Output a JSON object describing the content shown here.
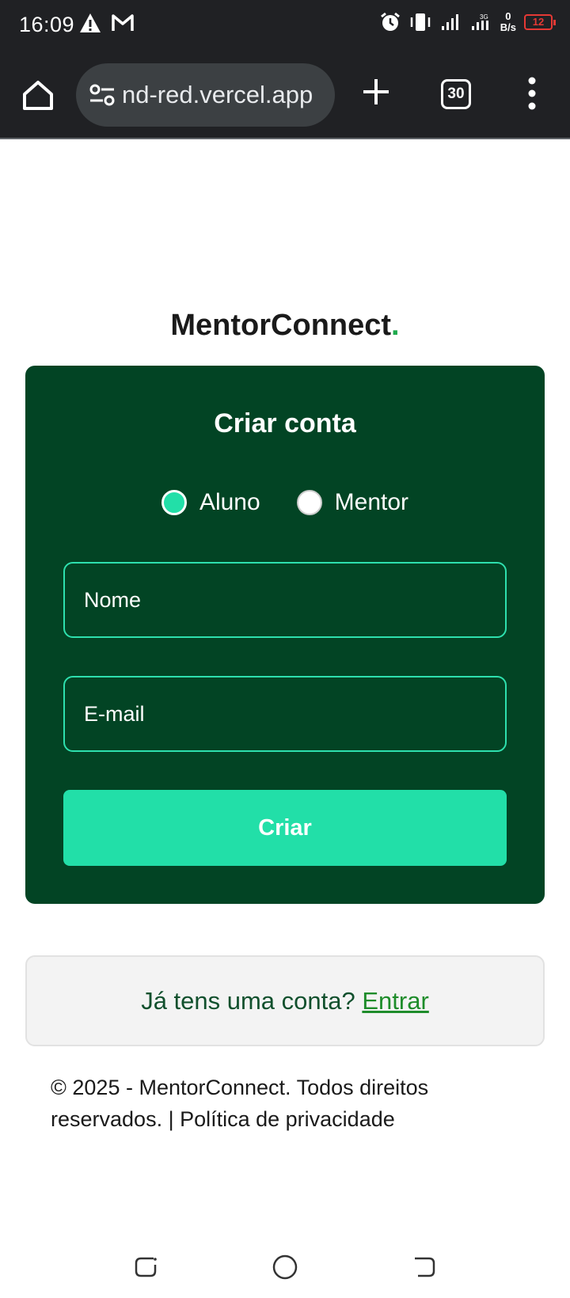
{
  "status_bar": {
    "time": "16:09",
    "net_speed_value": "0",
    "net_speed_unit": "B/s",
    "battery": "12"
  },
  "browser": {
    "url": "nd-red.vercel.app",
    "tab_count": "30"
  },
  "brand": {
    "name": "MentorConnect",
    "dot": "."
  },
  "signup": {
    "title": "Criar conta",
    "roles": [
      {
        "label": "Aluno",
        "selected": true
      },
      {
        "label": "Mentor",
        "selected": false
      }
    ],
    "name_placeholder": "Nome",
    "email_placeholder": "E-mail",
    "submit_label": "Criar"
  },
  "login_prompt": {
    "text": "Já tens uma conta?",
    "link": "Entrar"
  },
  "footer": {
    "text": "© 2025 - MentorConnect. Todos direitos reservados. | Política de privacidade"
  },
  "colors": {
    "card_bg": "#024424",
    "accent": "#22dfa8",
    "link_green": "#1e8c2a",
    "battery_low": "#e53935"
  }
}
